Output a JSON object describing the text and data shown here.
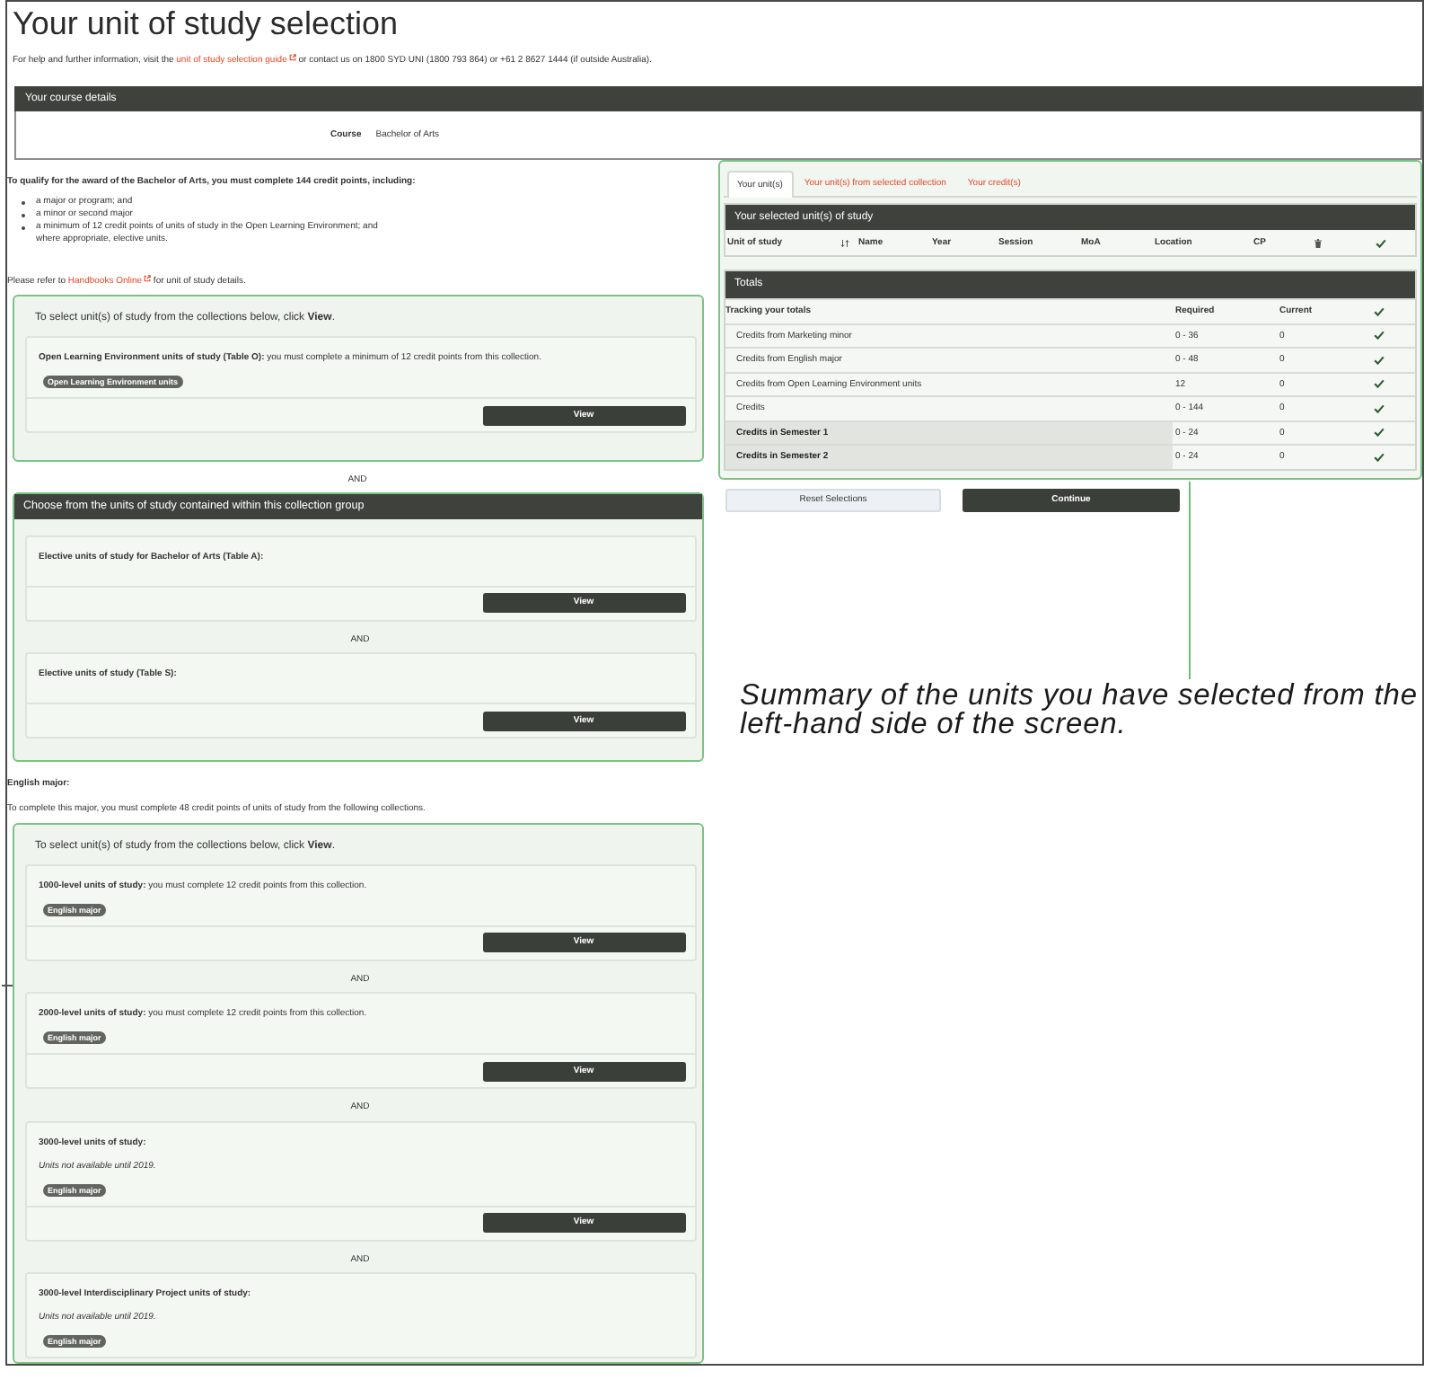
{
  "header": {
    "title": "Your unit of study selection",
    "help": {
      "before": "For help and further information, visit the",
      "link": "unit of study selection guide",
      "after": "or contact us on 1800 SYD UNI (1800 793 864) or +61 2 8627 1444 (if outside Australia)."
    }
  },
  "course_details": {
    "heading": "Your course details",
    "label": "Course",
    "value": "Bachelor of Arts"
  },
  "requirements": {
    "intro": "To qualify for the award of the Bachelor of Arts, you must complete 144 credit points, including:",
    "bullets": [
      "a major or program; and",
      "a minor or second major",
      "a minimum of 12 credit points of units of study in the Open Learning Environment; and where appropriate, elective units."
    ],
    "refer": {
      "before": "Please refer to",
      "link": "Handbooks Online",
      "after": "for unit of study details."
    }
  },
  "blocks": [
    {
      "kind": "collections",
      "instruction": "To select unit(s) of study from the collections below, click **View**.",
      "items": [
        {
          "kind": "card",
          "title": "Open Learning Environment units of study (Table O):",
          "description": "you must complete a minimum of 12 credit points from this collection.",
          "tag": "Open Learning Environment units",
          "button": "View"
        }
      ]
    },
    {
      "kind": "separator",
      "text": "AND"
    },
    {
      "kind": "group",
      "heading": "Choose from the units of study contained within this collection group",
      "items": [
        {
          "kind": "card",
          "title": "Elective units of study for Bachelor of Arts (Table A):",
          "button": "View"
        },
        {
          "kind": "separator",
          "text": "AND"
        },
        {
          "kind": "card",
          "title": "Elective units of study (Table S):",
          "button": "View"
        }
      ]
    },
    {
      "kind": "heading",
      "text": "English major:"
    },
    {
      "kind": "paragraph",
      "text": "To complete this major, you must complete 48 credit points of units of study from the following collections."
    },
    {
      "kind": "collections",
      "instruction": "To select unit(s) of study from the collections below, click **View**.",
      "items": [
        {
          "kind": "card",
          "title": "1000-level units of study:",
          "description": "you must complete 12 credit points from this collection.",
          "tag": "English major",
          "button": "View"
        },
        {
          "kind": "separator",
          "text": "AND"
        },
        {
          "kind": "card",
          "title": "2000-level units of study:",
          "description": "you must complete 12 credit points from this collection.",
          "tag": "English major",
          "button": "View"
        },
        {
          "kind": "separator",
          "text": "AND"
        },
        {
          "kind": "card",
          "title": "3000-level units of study:",
          "note": "Units not available until 2019.",
          "tag": "English major",
          "button": "View"
        },
        {
          "kind": "separator",
          "text": "AND"
        },
        {
          "kind": "card",
          "title": "3000-level Interdisciplinary Project units of study:",
          "note": "Units not available until 2019.",
          "tag": "English major"
        }
      ]
    }
  ],
  "summary_panel": {
    "tabs": [
      {
        "label": "Your unit(s)",
        "selected": true
      },
      {
        "label": "Your unit(s) from selected collection",
        "selected": false
      },
      {
        "label": "Your credit(s)",
        "selected": false
      }
    ],
    "selected_units": {
      "heading": "Your selected unit(s) of study",
      "columns": [
        {
          "kind": "text",
          "label": "Unit of study"
        },
        {
          "kind": "sort"
        },
        {
          "kind": "text",
          "label": "Name"
        },
        {
          "kind": "text",
          "label": "Year"
        },
        {
          "kind": "text",
          "label": "Session"
        },
        {
          "kind": "text",
          "label": "MoA"
        },
        {
          "kind": "text",
          "label": "Location"
        },
        {
          "kind": "text",
          "label": "CP"
        },
        {
          "kind": "delete"
        },
        {
          "kind": "status"
        }
      ]
    },
    "totals": {
      "heading": "Totals",
      "columns": [
        {
          "kind": "text",
          "label": "Tracking your totals"
        },
        {
          "kind": "text",
          "label": "Required"
        },
        {
          "kind": "text",
          "label": "Current"
        },
        {
          "kind": "status"
        }
      ],
      "rows": [
        {
          "label": "Credits from Marketing minor",
          "required": "0 - 36",
          "current": "0",
          "met": true,
          "highlighted": false
        },
        {
          "label": "Credits from English major",
          "required": "0 - 48",
          "current": "0",
          "met": true,
          "highlighted": false
        },
        {
          "label": "Credits from Open Learning Environment units",
          "required": "12",
          "current": "0",
          "met": true,
          "highlighted": false
        },
        {
          "label": "Credits",
          "required": "0 - 144",
          "current": "0",
          "met": true,
          "highlighted": false
        },
        {
          "label": "Credits in Semester 1",
          "required": "0 - 24",
          "current": "0",
          "met": true,
          "highlighted": true
        },
        {
          "label": "Credits in Semester 2",
          "required": "0 - 24",
          "current": "0",
          "met": true,
          "highlighted": true
        }
      ]
    },
    "buttons": [
      {
        "label": "Reset Selections",
        "kind": "secondary"
      },
      {
        "label": "Continue",
        "kind": "primary"
      }
    ]
  },
  "annotation": {
    "text": "Summary of the units you have selected from the left-hand side of the screen."
  }
}
